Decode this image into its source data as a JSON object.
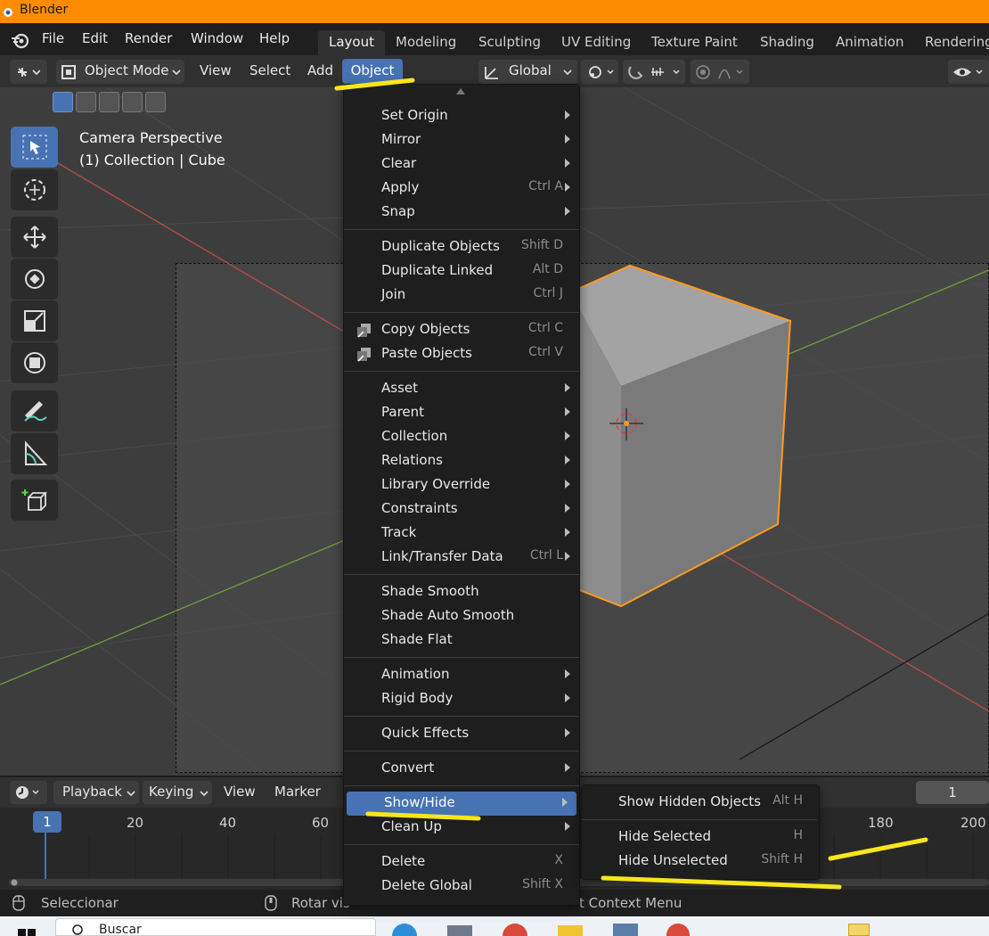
{
  "window": {
    "title": "Blender"
  },
  "topmenu": {
    "file": "File",
    "edit": "Edit",
    "render": "Render",
    "window": "Window",
    "help": "Help"
  },
  "workspaces": [
    "Layout",
    "Modeling",
    "Sculpting",
    "UV Editing",
    "Texture Paint",
    "Shading",
    "Animation",
    "Rendering"
  ],
  "viewport_header": {
    "mode": "Object Mode",
    "view": "View",
    "select": "Select",
    "add": "Add",
    "object": "Object",
    "transform_orientation": "Global"
  },
  "viewport_info": {
    "line1": "Camera Perspective",
    "line2": "(1) Collection | Cube"
  },
  "object_menu": {
    "groups": [
      [
        {
          "label": "Set Origin",
          "shortcut": "",
          "submenu": true
        },
        {
          "label": "Mirror",
          "shortcut": "",
          "submenu": true
        },
        {
          "label": "Clear",
          "shortcut": "",
          "submenu": true
        },
        {
          "label": "Apply",
          "shortcut": "Ctrl A",
          "submenu": true
        },
        {
          "label": "Snap",
          "shortcut": "",
          "submenu": true
        }
      ],
      [
        {
          "label": "Duplicate Objects",
          "shortcut": "Shift D",
          "submenu": false
        },
        {
          "label": "Duplicate Linked",
          "shortcut": "Alt D",
          "submenu": false
        },
        {
          "label": "Join",
          "shortcut": "Ctrl J",
          "submenu": false
        }
      ],
      [
        {
          "label": "Copy Objects",
          "shortcut": "Ctrl C",
          "submenu": false,
          "icon": "copy-icon"
        },
        {
          "label": "Paste Objects",
          "shortcut": "Ctrl V",
          "submenu": false,
          "icon": "paste-icon"
        }
      ],
      [
        {
          "label": "Asset",
          "shortcut": "",
          "submenu": true
        },
        {
          "label": "Parent",
          "shortcut": "",
          "submenu": true
        },
        {
          "label": "Collection",
          "shortcut": "",
          "submenu": true
        },
        {
          "label": "Relations",
          "shortcut": "",
          "submenu": true
        },
        {
          "label": "Library Override",
          "shortcut": "",
          "submenu": true
        },
        {
          "label": "Constraints",
          "shortcut": "",
          "submenu": true
        },
        {
          "label": "Track",
          "shortcut": "",
          "submenu": true
        },
        {
          "label": "Link/Transfer Data",
          "shortcut": "Ctrl L",
          "submenu": true
        }
      ],
      [
        {
          "label": "Shade Smooth",
          "shortcut": "",
          "submenu": false
        },
        {
          "label": "Shade Auto Smooth",
          "shortcut": "",
          "submenu": false
        },
        {
          "label": "Shade Flat",
          "shortcut": "",
          "submenu": false
        }
      ],
      [
        {
          "label": "Animation",
          "shortcut": "",
          "submenu": true
        },
        {
          "label": "Rigid Body",
          "shortcut": "",
          "submenu": true
        }
      ],
      [
        {
          "label": "Quick Effects",
          "shortcut": "",
          "submenu": true
        }
      ],
      [
        {
          "label": "Convert",
          "shortcut": "",
          "submenu": true
        }
      ],
      [
        {
          "label": "Show/Hide",
          "shortcut": "",
          "submenu": true,
          "highlighted": true
        },
        {
          "label": "Clean Up",
          "shortcut": "",
          "submenu": true
        }
      ],
      [
        {
          "label": "Delete",
          "shortcut": "X",
          "submenu": false
        },
        {
          "label": "Delete Global",
          "shortcut": "Shift X",
          "submenu": false
        }
      ]
    ]
  },
  "show_hide_submenu": [
    {
      "label": "Show Hidden Objects",
      "shortcut": "Alt H"
    },
    {
      "label": "Hide Selected",
      "shortcut": "H"
    },
    {
      "label": "Hide Unselected",
      "shortcut": "Shift H"
    }
  ],
  "timeline": {
    "playback": "Playback",
    "keying": "Keying",
    "view": "View",
    "marker": "Marker",
    "current_frame": "1",
    "frame_field": "1",
    "ticks": [
      "20",
      "40",
      "60",
      "180",
      "200"
    ]
  },
  "statusbar": {
    "left": "Seleccionar",
    "middle": "Rotar vis",
    "right": "t Context Menu"
  },
  "taskbar": {
    "search": "Buscar"
  },
  "colors": {
    "accent": "#4772b3",
    "titlebar": "#ff8c00",
    "highlight_marker": "#f7e619",
    "selection_outline": "#ff9a1f"
  }
}
